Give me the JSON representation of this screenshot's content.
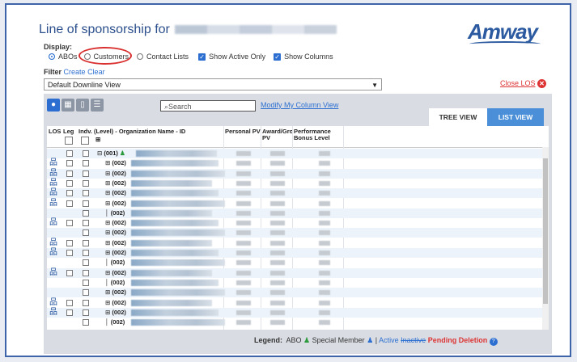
{
  "header": {
    "title": "Line of sponsorship for",
    "logo": "Amway"
  },
  "display": {
    "label": "Display:",
    "options": [
      "ABOs",
      "Customers",
      "Contact Lists"
    ],
    "selected": "ABOs",
    "show_active_only": "Show Active Only",
    "show_columns": "Show Columns"
  },
  "filter": {
    "label": "Filter",
    "create": "Create",
    "clear": "Clear"
  },
  "view_select": {
    "value": "Default Downline View"
  },
  "close_los": "Close LOS",
  "toolbar": {
    "search_placeholder": "Search",
    "modify_link": "Modify My Column View"
  },
  "tabs": {
    "tree": "TREE VIEW",
    "list": "LIST VIEW",
    "active": "LIST VIEW"
  },
  "columns": {
    "los": "LOS",
    "leg": "Leg",
    "indv": "Indv.",
    "name": "(Level) - Organization Name - ID",
    "ppv": "Personal PV",
    "award": "Award/Gro PV",
    "bonus": "Performance Bonus Level"
  },
  "rows": [
    {
      "level": "(001)",
      "los": false,
      "leg": true,
      "root": true
    },
    {
      "level": "(002)",
      "los": true,
      "leg": true
    },
    {
      "level": "(002)",
      "los": true,
      "leg": true
    },
    {
      "level": "(002)",
      "los": true,
      "leg": true
    },
    {
      "level": "(002)",
      "los": true,
      "leg": true
    },
    {
      "level": "(002)",
      "los": true,
      "leg": true
    },
    {
      "level": "(002)",
      "los": false,
      "leg": false,
      "leaf": true
    },
    {
      "level": "(002)",
      "los": true,
      "leg": true
    },
    {
      "level": "(002)",
      "los": false,
      "leg": false
    },
    {
      "level": "(002)",
      "los": true,
      "leg": true
    },
    {
      "level": "(002)",
      "los": true,
      "leg": true
    },
    {
      "level": "(002)",
      "los": false,
      "leg": false,
      "leaf": true
    },
    {
      "level": "(002)",
      "los": true,
      "leg": true
    },
    {
      "level": "(002)",
      "los": false,
      "leg": false,
      "leaf": true
    },
    {
      "level": "(002)",
      "los": false,
      "leg": false
    },
    {
      "level": "(002)",
      "los": true,
      "leg": true
    },
    {
      "level": "(002)",
      "los": true,
      "leg": true
    },
    {
      "level": "(002)",
      "los": false,
      "leg": false,
      "leaf": true
    }
  ],
  "legend": {
    "label": "Legend:",
    "abo": "ABO",
    "special": "Special Member",
    "sep": "|",
    "active": "Active",
    "inactive": "Inactive",
    "pending": "Pending Deletion"
  },
  "colors": {
    "brand": "#2c5aa0",
    "accent": "#2d6fd1",
    "danger": "#d33333",
    "highlight_circle": "#d93030"
  }
}
